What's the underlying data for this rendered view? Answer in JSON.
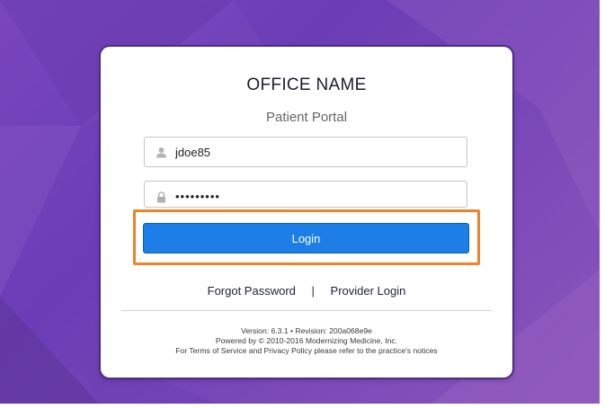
{
  "colors": {
    "background": "#7a46bd",
    "card": "#ffffff",
    "login_button": "#1c7ee6",
    "highlight_border": "#f08228"
  },
  "header": {
    "office_name": "OFFICE NAME",
    "portal_name": "Patient Portal"
  },
  "form": {
    "username": {
      "value": "jdoe85",
      "icon": "user-icon"
    },
    "password": {
      "value": "•••••••••",
      "icon": "lock-icon"
    },
    "login_label": "Login"
  },
  "links": {
    "forgot_password": "Forgot Password",
    "separator": "|",
    "provider_login": "Provider Login"
  },
  "footer": {
    "version_line": "Version: 6.3.1 • Revision: 200a068e9e",
    "powered_line": "Powered by © 2010-2016 Modernizing Medicine, Inc.",
    "terms_line": "For Terms of Service and Privacy Policy please refer to the practice's notices"
  }
}
